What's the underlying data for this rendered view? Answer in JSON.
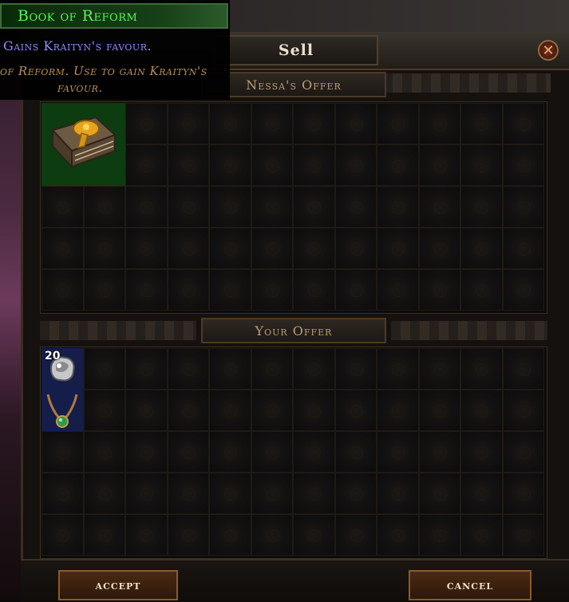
{
  "tooltip": {
    "title": "Book of Reform",
    "mod_line": "Gains Kraityn's favour.",
    "desc_line1": "of Reform. Use to gain Kraityn's",
    "desc_line2": "favour."
  },
  "header": {
    "sell_tab": "Sell",
    "close_icon": "close-icon"
  },
  "sections": {
    "vendor_offer": "Nessa's Offer",
    "your_offer": "Your Offer"
  },
  "vendor_items": [
    {
      "name": "Book of Reform",
      "icon": "book-icon"
    }
  ],
  "your_items": [
    {
      "name": "orb",
      "icon": "orb-icon",
      "stack": "20"
    },
    {
      "name": "amulet",
      "icon": "amulet-icon"
    }
  ],
  "buttons": {
    "accept": "accept",
    "cancel": "cancel"
  },
  "colors": {
    "tooltip_title": "#5cf25c",
    "tooltip_mod": "#8d8dff",
    "tooltip_desc": "#b9904e",
    "quest_item_bg": "#0c3c0f",
    "unique_item_bg": "#151e4a"
  }
}
